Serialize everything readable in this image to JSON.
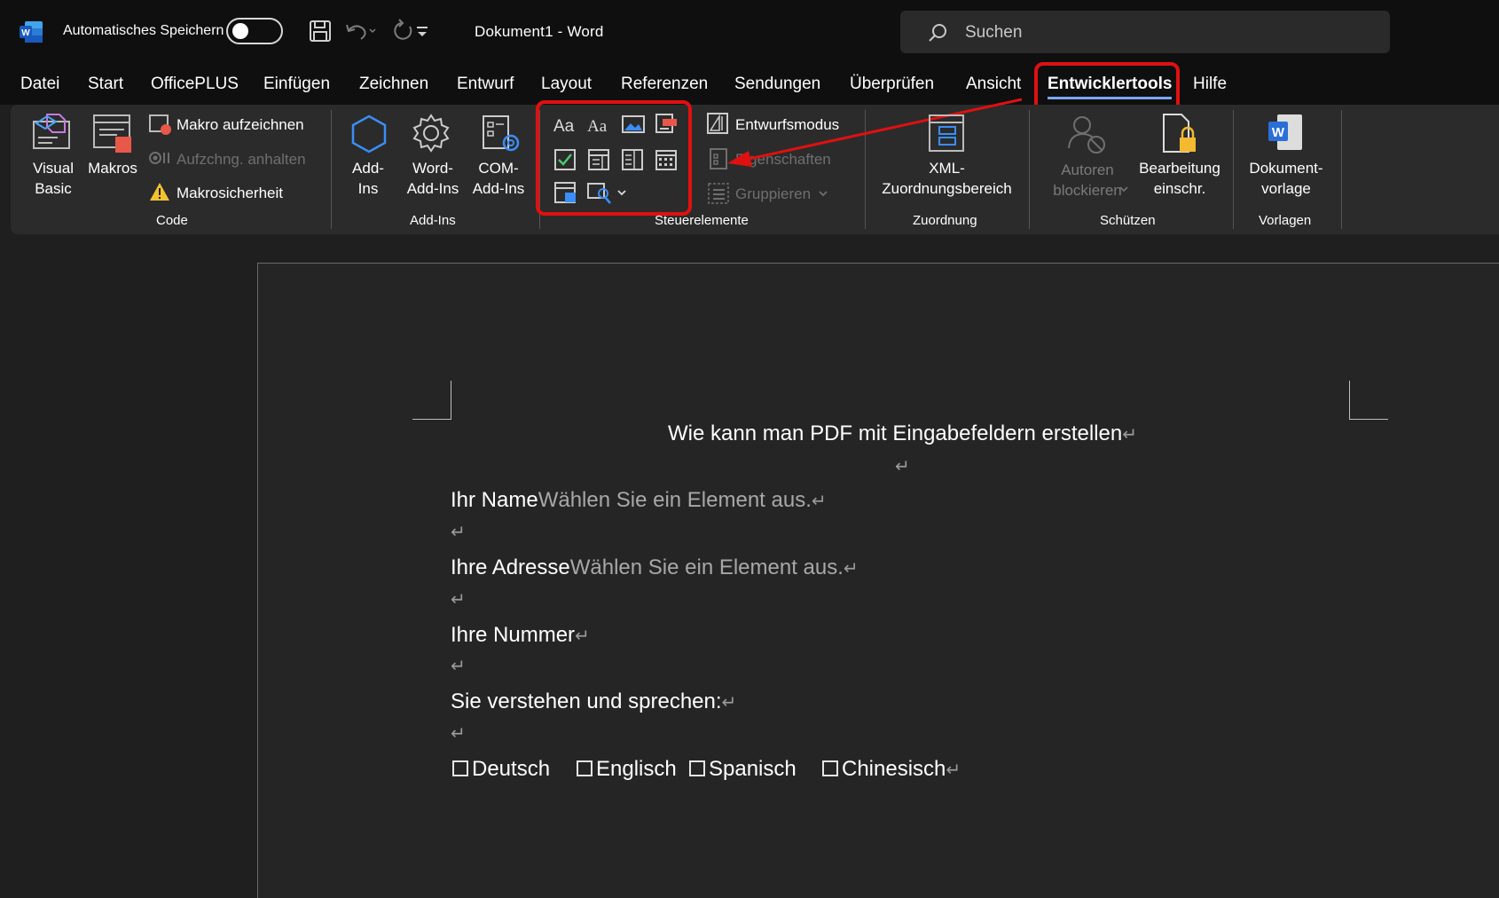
{
  "titlebar": {
    "autosave_label": "Automatisches Speichern",
    "doc_title": "Dokument1  -  Word",
    "search_placeholder": "Suchen"
  },
  "menu": {
    "items": [
      "Datei",
      "Start",
      "OfficePLUS",
      "Einfügen",
      "Zeichnen",
      "Entwurf",
      "Layout",
      "Referenzen",
      "Sendungen",
      "Überprüfen",
      "Ansicht",
      "Entwicklertools",
      "Hilfe"
    ],
    "active": "Entwicklertools"
  },
  "ribbon": {
    "code": {
      "visual_basic": [
        "Visual",
        "Basic"
      ],
      "makros": "Makros",
      "makro_aufzeichnen": "Makro aufzeichnen",
      "aufzeichnung_anhalten": "Aufzchng. anhalten",
      "makrosicherheit": "Makrosicherheit",
      "label": "Code"
    },
    "addins": {
      "add_ins": [
        "Add-",
        "Ins"
      ],
      "word_add_ins": [
        "Word-",
        "Add-Ins"
      ],
      "com_add_ins": [
        "COM-",
        "Add-Ins"
      ],
      "label": "Add-Ins"
    },
    "steuerelemente": {
      "entwurfsmodus": "Entwurfsmodus",
      "eigenschaften": "Eigenschaften",
      "gruppieren": "Gruppieren",
      "label": "Steuerelemente"
    },
    "zuordnung": {
      "xml": [
        "XML-",
        "Zuordnungsbereich"
      ],
      "label": "Zuordnung"
    },
    "schuetzen": {
      "autoren": [
        "Autoren",
        "blockieren"
      ],
      "bearbeitung": [
        "Bearbeitung",
        "einschr."
      ],
      "label": "Schützen"
    },
    "vorlagen": {
      "dokumentvorlage": [
        "Dokument-",
        "vorlage"
      ],
      "label": "Vorlagen"
    }
  },
  "document": {
    "title": "Wie kann man PDF mit Eingabefeldern erstellen",
    "fields": [
      {
        "label": "Ihr Name",
        "placeholder": "Wählen Sie ein Element aus."
      },
      {
        "label": "Ihre Adresse",
        "placeholder": "Wählen Sie ein Element aus."
      },
      {
        "label": "Ihre Nummer",
        "placeholder": ""
      },
      {
        "label": "Sie verstehen und sprechen:",
        "placeholder": ""
      }
    ],
    "checkboxes": [
      "Deutsch",
      "Englisch",
      "Spanisch",
      "Chinesisch"
    ],
    "para_mark": "↵"
  },
  "colors": {
    "highlight": "#e01010",
    "accent": "#7aa7ff",
    "word_blue": "#2b6fd6"
  }
}
